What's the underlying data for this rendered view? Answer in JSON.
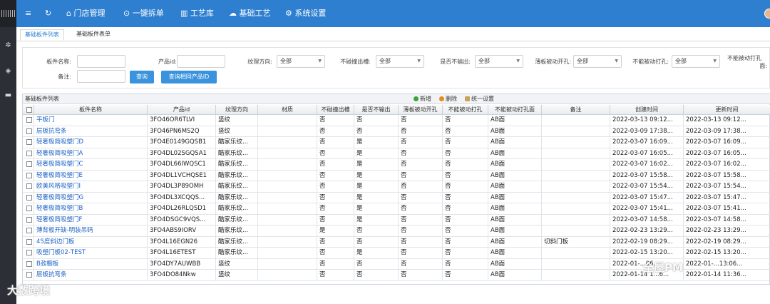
{
  "nav": {
    "items": [
      {
        "icon": "menu-icon",
        "label": ""
      },
      {
        "icon": "refresh-icon",
        "label": ""
      },
      {
        "icon": "home-icon",
        "label": "门店管理"
      },
      {
        "icon": "check-circle-icon",
        "label": "一键拆单"
      },
      {
        "icon": "library-icon",
        "label": "工艺库"
      },
      {
        "icon": "cloud-icon",
        "label": "基础工艺"
      },
      {
        "icon": "gear-icon",
        "label": "系统设置"
      }
    ]
  },
  "tabs": [
    "基础板件列表",
    "基础板件表单"
  ],
  "filter": {
    "name_label": "板件名称:",
    "pid_label": "产品id:",
    "grain_label": "纹理方向:",
    "grain_value": "全部",
    "nogroove_label": "不碰撞出槽:",
    "nogroove_value": "全部",
    "nooutput_label": "是否不输出:",
    "nooutput_value": "全部",
    "thin_label": "薄板被动开孔:",
    "thin_value": "全部",
    "nohole_label": "不能被动打孔:",
    "nohole_value": "全部",
    "nohole_face_label": "不能被动打孔",
    "nohole_face_label2": "面:",
    "note_label": "备注:",
    "query_btn": "查询",
    "query_same_btn": "查询相同产品ID"
  },
  "grid": {
    "title": "基础板件列表",
    "add": "新增",
    "delete": "删除",
    "settings": "统一设置",
    "columns": [
      "板件名称",
      "产品id",
      "纹理方向",
      "材质",
      "不碰撞出槽",
      "是否不输出",
      "薄板被动开孔",
      "不能被动打孔",
      "不能被动打孔面",
      "备注",
      "创建时间",
      "更新时间"
    ],
    "rows": [
      [
        "平板门",
        "3FO46OR6TLVI",
        "竖纹",
        "",
        "否",
        "否",
        "否",
        "否",
        "AB面",
        "",
        "2022-03-13 09:12...",
        "2022-03-13 09:12..."
      ],
      [
        "层板抗弯条",
        "3FO46PN6MS2Q",
        "竖纹",
        "",
        "否",
        "否",
        "否",
        "否",
        "AB面",
        "",
        "2022-03-09 17:38...",
        "2022-03-09 17:38..."
      ],
      [
        "轻奢极简吸塑门D",
        "3FO4E0149GQSB1",
        "酷家乐纹...",
        "",
        "否",
        "是",
        "否",
        "否",
        "AB面",
        "",
        "2022-03-07 16:09...",
        "2022-03-07 16:09..."
      ],
      [
        "轻奢极简吸塑门A",
        "3FO4DL02SGQSA1",
        "酷家乐纹...",
        "",
        "否",
        "是",
        "否",
        "否",
        "AB面",
        "",
        "2022-03-07 16:05...",
        "2022-03-07 16:05..."
      ],
      [
        "轻奢极简吸塑门C",
        "3FO4DL66IWQSC1",
        "酷家乐纹...",
        "",
        "否",
        "是",
        "否",
        "否",
        "AB面",
        "",
        "2022-03-07 16:02...",
        "2022-03-07 16:02..."
      ],
      [
        "轻奢极简吸塑门E",
        "3FO4DL1VCHQSE1",
        "酷家乐纹...",
        "",
        "否",
        "是",
        "否",
        "否",
        "AB面",
        "",
        "2022-03-07 15:58...",
        "2022-03-07 15:58..."
      ],
      [
        "欧美风格吸塑门I",
        "3FO4DL3P89OMH",
        "酷家乐纹...",
        "",
        "否",
        "是",
        "否",
        "否",
        "AB面",
        "",
        "2022-03-07 15:54...",
        "2022-03-07 15:54..."
      ],
      [
        "轻奢极简吸塑门G",
        "3FO4DL3XCQQS...",
        "酷家乐纹...",
        "",
        "否",
        "是",
        "否",
        "否",
        "AB面",
        "",
        "2022-03-07 15:47...",
        "2022-03-07 15:47..."
      ],
      [
        "轻奢极简吸塑门B",
        "3FO4DL26RLQSD1",
        "酷家乐纹...",
        "",
        "否",
        "是",
        "否",
        "否",
        "AB面",
        "",
        "2022-03-07 15:41...",
        "2022-03-07 15:41..."
      ],
      [
        "轻奢极简吸塑门F",
        "3FO4DSGC9VQS...",
        "酷家乐纹...",
        "",
        "否",
        "是",
        "否",
        "否",
        "AB面",
        "",
        "2022-03-07 14:58...",
        "2022-03-07 14:58..."
      ],
      [
        "薄背板开缺-明装吊码",
        "3FO4ABS9IORV",
        "酷家乐纹...",
        "",
        "是",
        "否",
        "否",
        "否",
        "AB面",
        "",
        "2022-02-23 13:29...",
        "2022-02-23 13:29..."
      ],
      [
        "45度斜边门板",
        "3FO4L16EGN26",
        "酷家乐纹...",
        "",
        "否",
        "否",
        "否",
        "否",
        "AB面",
        "切斜门板",
        "2022-02-19 08:29...",
        "2022-02-19 08:29..."
      ],
      [
        "吸塑门板02-TEST",
        "3FO4L16ETEST",
        "酷家乐纹...",
        "",
        "否",
        "是",
        "否",
        "否",
        "AB面",
        "",
        "2022-02-15 13:20...",
        "2022-02-15 13:20..."
      ],
      [
        "B款橱板",
        "3FO4DY7AUWBB",
        "竖纹",
        "",
        "否",
        "否",
        "否",
        "否",
        "AB面",
        "",
        "2022-01-...06...",
        "2022-01-...13:06..."
      ],
      [
        "层板抗弯条",
        "3FO4DO84Nkw",
        "竖纹",
        "",
        "否",
        "否",
        "否",
        "否",
        "AB面",
        "",
        "2022-01-14 1...6...",
        "2022-01-14 11:36..."
      ]
    ]
  },
  "watermark_left": "大数跨境",
  "watermark_right": "全屋PM"
}
